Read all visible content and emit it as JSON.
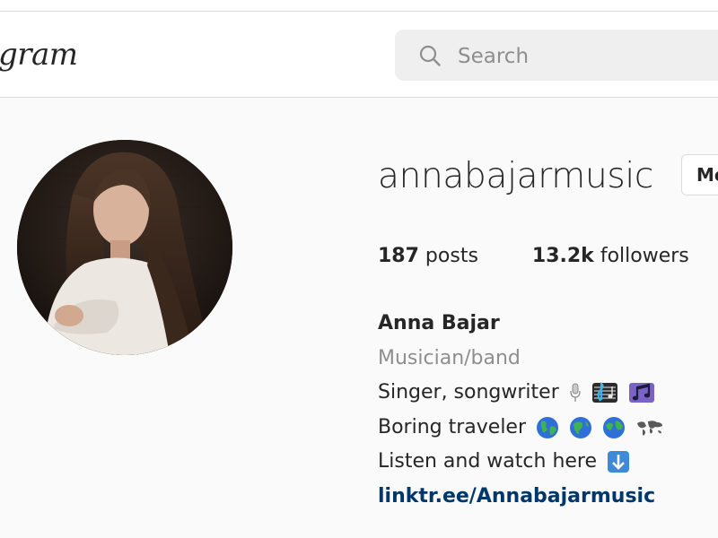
{
  "header": {
    "logo_text": "gram",
    "search_placeholder": "Search"
  },
  "profile": {
    "username": "annabajarmusic",
    "message_button": "Message",
    "stats": {
      "posts_count": "187",
      "posts_label": " posts",
      "followers_count": "13.2k",
      "followers_label": " followers"
    },
    "bio": {
      "name": "Anna Bajar",
      "category": "Musician/band",
      "line1": "Singer, songwriter",
      "line2": "Boring traveler",
      "line3": "Listen and watch here",
      "link": "linktr.ee/Annabajarmusic"
    },
    "bio_emojis": {
      "line1": [
        "microphone-icon",
        "musical-score-icon",
        "musical-notes-icon"
      ],
      "line2": [
        "globe-icon",
        "globe-icon",
        "globe-icon",
        "world-map-icon"
      ],
      "line3": [
        "down-arrow-icon"
      ]
    }
  },
  "colors": {
    "background": "#fafafa",
    "link": "#00376b",
    "secondary_text": "#8e8e8e",
    "search_bg": "#efefef",
    "border": "#dbdbdb"
  }
}
